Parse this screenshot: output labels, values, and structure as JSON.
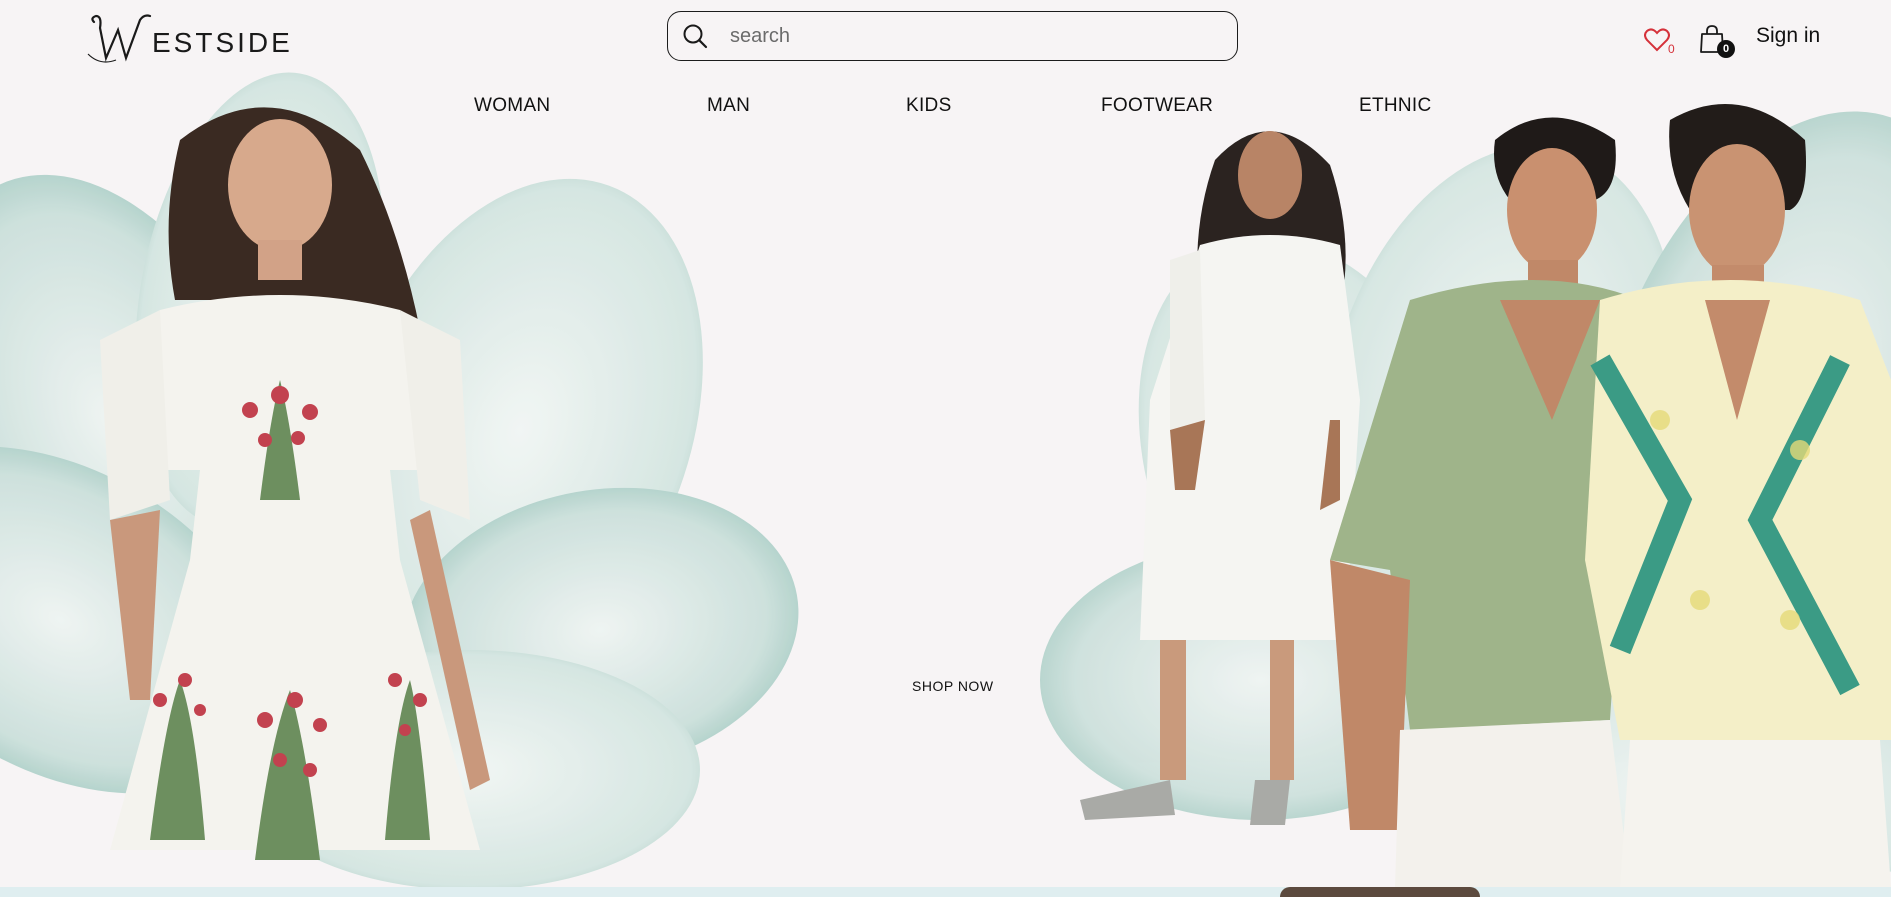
{
  "brand": {
    "name_rest": "ESTSIDE"
  },
  "search": {
    "placeholder": "search"
  },
  "header": {
    "wishlist_count": "0",
    "cart_count": "0",
    "signin_label": "Sign in"
  },
  "nav": {
    "items": [
      {
        "label": "WOMAN"
      },
      {
        "label": "MAN"
      },
      {
        "label": "KIDS"
      },
      {
        "label": "FOOTWEAR"
      },
      {
        "label": "ETHNIC"
      }
    ]
  },
  "hero": {
    "cta_label": "SHOP NOW"
  },
  "colors": {
    "background": "#f7f4f5",
    "wishlist_red": "#d5313a",
    "petal_green": "#a9cdc5"
  }
}
